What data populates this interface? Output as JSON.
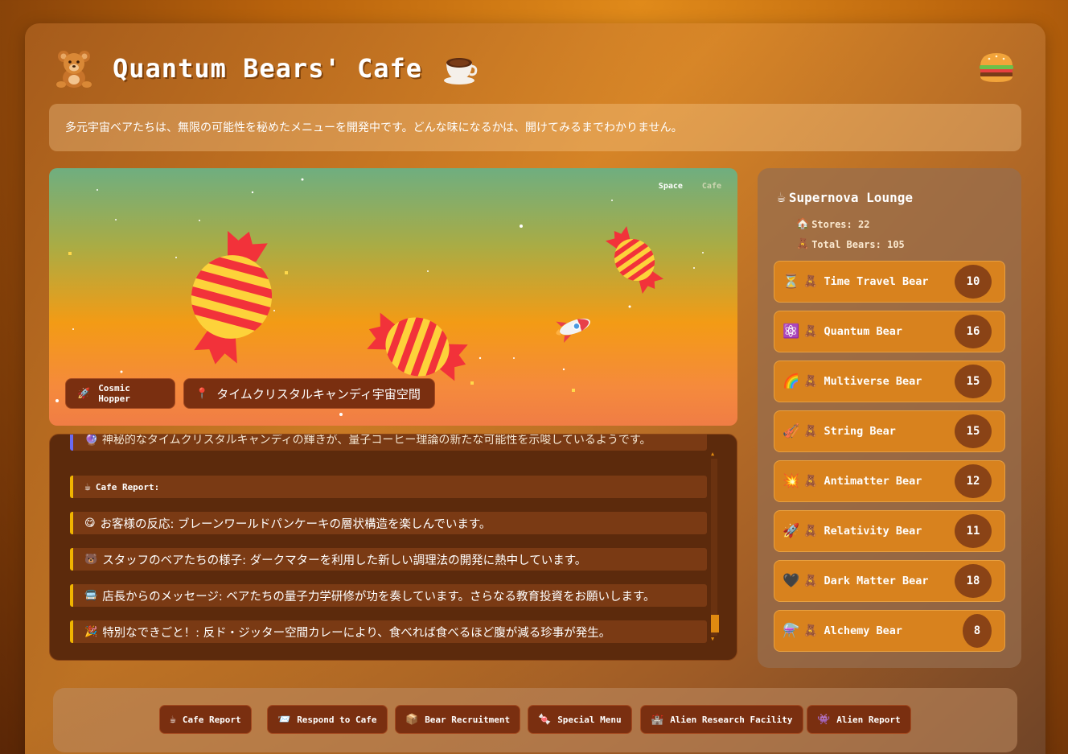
{
  "header": {
    "title": "Quantum Bears' Cafe",
    "logo_icon": "teddy-bear-icon",
    "cup_icon": "coffee-cup-icon",
    "burger_icon": "burger-icon"
  },
  "description": "多元宇宙ベアたちは、無限の可能性を秘めたメニューを開発中です。どんな味になるかは、開けてみるまでわかりません。",
  "scene": {
    "nav": [
      "Space",
      "Cafe"
    ],
    "vehicle_label": "Cosmic Hopper",
    "vehicle_icon": "🚀",
    "location_label": "タイムクリスタルキャンディ宇宙空間",
    "location_icon": "📍"
  },
  "log": {
    "cut_off_line": "🔮 神秘的なタイムクリスタルキャンディの輝きが、量子コーヒー理論の新たな可能性を示唆しているようです。",
    "heading": "Cafe Report:",
    "heading_icon": "☕",
    "entries": [
      {
        "icon": "😋",
        "text": "お客様の反応: ブレーンワールドパンケーキの層状構造を楽しんでいます。"
      },
      {
        "icon": "🐻",
        "text": "スタッフのベアたちの様子: ダークマターを利用した新しい調理法の開発に熱中しています。"
      },
      {
        "icon": "🚍",
        "text": "店長からのメッセージ: ベアたちの量子力学研修が功を奏しています。さらなる教育投資をお願いします。"
      },
      {
        "icon": "🎉",
        "text": "特別なできごと！: 反ド・ジッター空間カレーにより、食べれば食べるほど腹が減る珍事が発生。"
      }
    ]
  },
  "sidebar": {
    "title": "Supernova Lounge",
    "title_icon": "☕",
    "stores_label": "Stores: 22",
    "stores_icon": "🏠",
    "bears_label": "Total Bears: 105",
    "bears_icon": "🧸",
    "bears": [
      {
        "icon": "⏳",
        "name": "Time Travel Bear",
        "count": "10"
      },
      {
        "icon": "⚛️",
        "name": "Quantum Bear",
        "count": "16"
      },
      {
        "icon": "🌈",
        "name": "Multiverse Bear",
        "count": "15"
      },
      {
        "icon": "🎻",
        "name": "String Bear",
        "count": "15"
      },
      {
        "icon": "💥",
        "name": "Antimatter Bear",
        "count": "12"
      },
      {
        "icon": "🚀",
        "name": "Relativity Bear",
        "count": "11"
      },
      {
        "icon": "🖤",
        "name": "Dark Matter Bear",
        "count": "18"
      },
      {
        "icon": "⚗️",
        "name": "Alchemy Bear",
        "count": "8"
      }
    ],
    "teddy": "🧸"
  },
  "footer": {
    "buttons": [
      {
        "icon": "☕",
        "label": "Cafe Report"
      },
      {
        "icon": "📨",
        "label": "Respond to Cafe"
      },
      {
        "icon": "📦",
        "label": "Bear Recruitment"
      },
      {
        "icon": "🍬",
        "label": "Special Menu"
      },
      {
        "icon": "🏰",
        "label": "Alien Research Facility"
      },
      {
        "icon": "👾",
        "label": "Alien Report"
      }
    ]
  },
  "colors": {
    "accent": "#d8821e",
    "chip": "#7a2f10",
    "log_border": "#f0b400",
    "candy_red": "#f2323a",
    "candy_yellow": "#fdd23a"
  }
}
